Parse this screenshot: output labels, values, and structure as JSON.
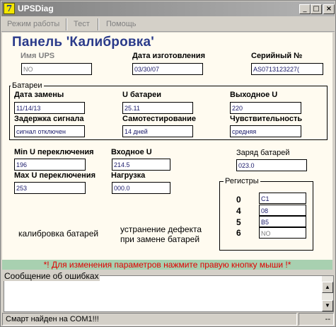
{
  "window": {
    "title": "UPSDiag",
    "icon_char": "7",
    "minimize": "_",
    "maximize": "□",
    "close": "×"
  },
  "menu": {
    "items": [
      "Режим работы",
      "Тест",
      "Помощь"
    ]
  },
  "panel": {
    "title": "Панель 'Калибровка'",
    "ups_name": {
      "label": "Имя UPS",
      "value": "NO"
    },
    "manufacture_date": {
      "label": "Дата изготовления",
      "value": "03/30/07"
    },
    "serial": {
      "label": "Серийный №",
      "value": "AS0713123227("
    },
    "battery_group": {
      "legend": "Батареи",
      "replace_date": {
        "label": "Дата замены",
        "value": "11/14/13"
      },
      "battery_u": {
        "label": "U батареи",
        "value": "25.11"
      },
      "output_u": {
        "label": "Выходное U",
        "value": "220"
      },
      "signal_delay": {
        "label": "Задержка сигнала",
        "value": "сигнал отключен"
      },
      "self_test": {
        "label": "Самотестирование",
        "value": "14 дней"
      },
      "sensitivity": {
        "label": "Чувствительность",
        "value": "средняя"
      }
    },
    "min_u": {
      "label": "Min U переключения",
      "value": "196"
    },
    "input_u": {
      "label": "Входное U",
      "value": "214.5"
    },
    "charge": {
      "label": "Заряд батарей",
      "value": "023.0"
    },
    "max_u": {
      "label": "Max U переключения",
      "value": "253"
    },
    "load": {
      "label": "Нагрузка",
      "value": "000.0"
    },
    "registers": {
      "legend": "Регистры",
      "rows": [
        {
          "num": "0",
          "value": "C1"
        },
        {
          "num": "4",
          "value": "08"
        },
        {
          "num": "5",
          "value": "B5"
        },
        {
          "num": "6",
          "value": "NO"
        }
      ]
    },
    "calibration_text": "калибровка батарей",
    "fix_text_1": "устранение дефекта",
    "fix_text_2": "при замене батарей"
  },
  "hint": "*! Для изменения параметров нажмите правую кнопку мыши !*",
  "errors": {
    "legend": "Сообщение об ошибках",
    "scroll_up": "▲",
    "scroll_down": "▼"
  },
  "status": {
    "main": "Смарт найден на COM1!!!",
    "secondary": "--"
  }
}
